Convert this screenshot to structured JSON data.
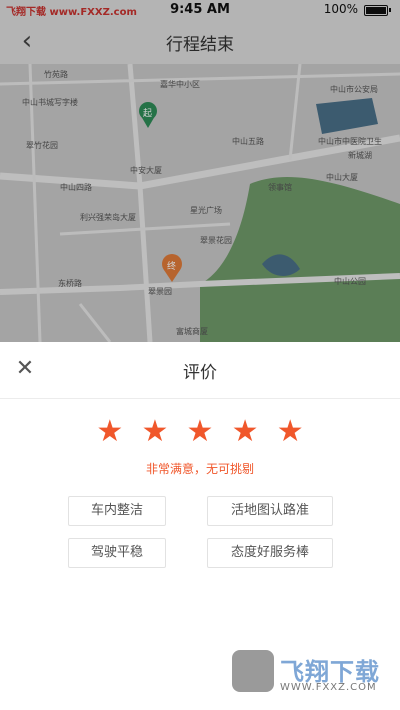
{
  "status_bar": {
    "left_text": "飞翔下载 www.FXXZ.com",
    "time": "9:45 AM",
    "battery_pct": "100%"
  },
  "nav": {
    "back_icon": "chevron-left-icon",
    "title": "行程结束"
  },
  "map": {
    "labels": [
      "竹苑路",
      "嘉华中小区",
      "中山市公安局",
      "中山书城写字楼",
      "中山市中医院卫生",
      "翠竹花园",
      "中山五路",
      "新城湖",
      "中安大厦",
      "中山四路",
      "利兴强荣岛大厦",
      "星光广场",
      "领事馆",
      "翠景花园",
      "中山大厦",
      "东桥路",
      "中山公园",
      "翠景园",
      "富城商厦"
    ],
    "start_pin_label": "起",
    "end_pin_label": "终"
  },
  "rating": {
    "close_icon": "close-icon",
    "title": "评价",
    "stars": [
      "★",
      "★",
      "★",
      "★",
      "★"
    ],
    "selected": 5,
    "max": 5,
    "comment": "非常满意，无可挑剔",
    "tags": [
      "车内整洁",
      "活地图认路准",
      "驾驶平稳",
      "态度好服务棒"
    ]
  },
  "watermark": {
    "text": "飞翔下载",
    "url": "WWW.FXXZ.COM"
  },
  "colors": {
    "accent": "#f0572b",
    "map_green": "#6f9a6a",
    "start_pin": "#2e8b57",
    "end_pin": "#e07b39"
  }
}
